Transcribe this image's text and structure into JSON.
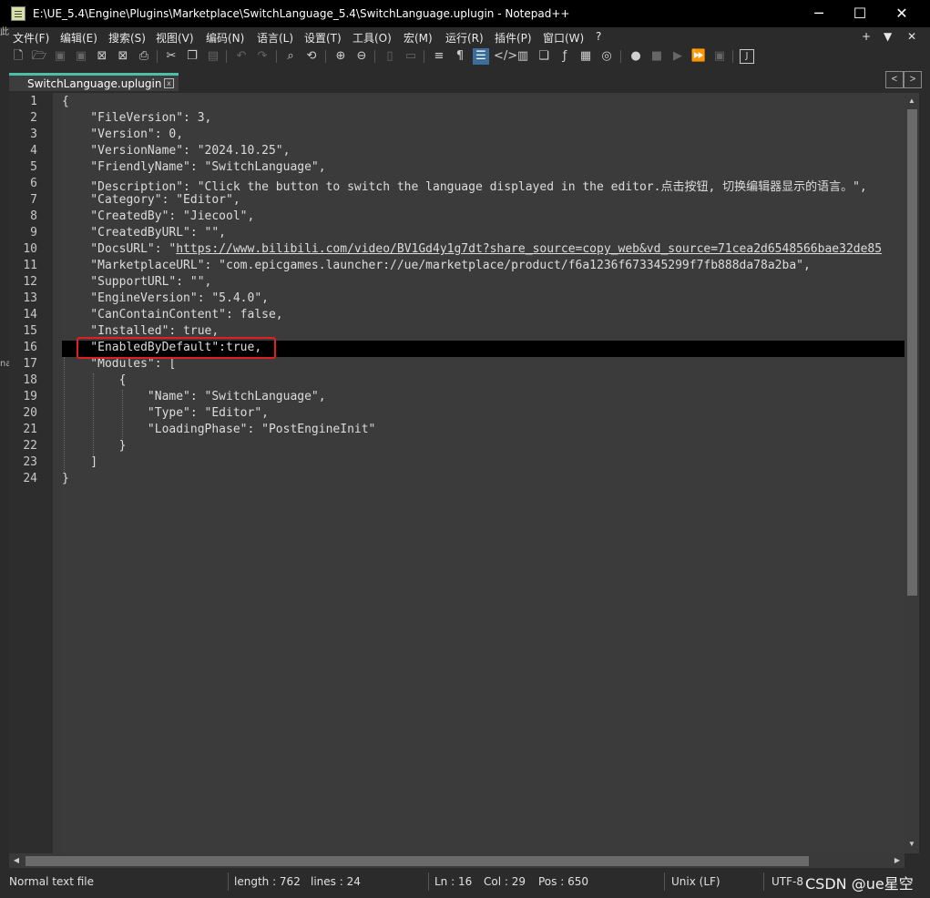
{
  "window": {
    "title": "E:\\UE_5.4\\Engine\\Plugins\\Marketplace\\SwitchLanguage_5.4\\SwitchLanguage.uplugin - Notepad++",
    "minimize": "─",
    "maximize": "☐",
    "close": "✕"
  },
  "menu": {
    "items": [
      "文件(F)",
      "编辑(E)",
      "搜索(S)",
      "视图(V)",
      "编码(N)",
      "语言(L)",
      "设置(T)",
      "工具(O)",
      "宏(M)",
      "运行(R)",
      "插件(P)",
      "窗口(W)",
      "?"
    ],
    "right": [
      "+",
      "▼",
      "✕"
    ]
  },
  "toolbar": {
    "icons": [
      "new-file-icon",
      "open-file-icon",
      "save-icon",
      "save-all-icon",
      "close-icon",
      "close-all-icon",
      "print-icon",
      "cut-icon",
      "copy-icon",
      "paste-icon",
      "undo-icon",
      "redo-icon",
      "find-icon",
      "replace-icon",
      "zoom-in-icon",
      "zoom-out-icon",
      "sync-vertical-icon",
      "sync-horizontal-icon",
      "word-wrap-icon",
      "show-all-chars-icon",
      "indent-guide-icon",
      "udl-icon",
      "doc-map-icon",
      "doc-list-icon",
      "function-list-icon",
      "folder-workspace-icon",
      "monitor-icon",
      "record-macro-icon",
      "stop-record-icon",
      "play-macro-icon",
      "run-macro-multiple-icon",
      "save-macro-icon",
      "json-plugin-icon"
    ]
  },
  "tab": {
    "label": "SwitchLanguage.uplugin",
    "close": "x"
  },
  "tab_nav": {
    "prev": "<",
    "next": ">"
  },
  "editor": {
    "line_numbers": [
      "1",
      "2",
      "3",
      "4",
      "5",
      "6",
      "7",
      "8",
      "9",
      "10",
      "11",
      "12",
      "13",
      "14",
      "15",
      "16",
      "17",
      "18",
      "19",
      "20",
      "21",
      "22",
      "23",
      "24"
    ],
    "lines": [
      "{",
      "    \"FileVersion\": 3,",
      "    \"Version\": 0,",
      "    \"VersionName\": \"2024.10.25\",",
      "    \"FriendlyName\": \"SwitchLanguage\",",
      "    \"Description\": \"Click the button to switch the language displayed in the editor.点击按钮, 切换编辑器显示的语言。\",",
      "    \"Category\": \"Editor\",",
      "    \"CreatedBy\": \"Jiecool\",",
      "    \"CreatedByURL\": \"\",",
      "    \"DocsURL\": \"",
      "    \"MarketplaceURL\": \"com.epicgames.launcher://ue/marketplace/product/f6a1236f673345299f7fb888da78a2ba\",",
      "    \"SupportURL\": \"\",",
      "    \"EngineVersion\": \"5.4.0\",",
      "    \"CanContainContent\": false,",
      "    \"Installed\": true,",
      "    \"EnabledByDefault\":true,",
      "    \"Modules\": [",
      "        {",
      "            \"Name\": \"SwitchLanguage\",",
      "            \"Type\": \"Editor\",",
      "            \"LoadingPhase\": \"PostEngineInit\"",
      "        }",
      "    ]",
      "}"
    ],
    "docs_url": "https://www.bilibili.com/video/BV1Gd4y1g7dt?share_source=copy_web&vd_source=71cea2d6548566bae32de85"
  },
  "status": {
    "file_type": "Normal text file",
    "length": "length : 762",
    "lines": "lines : 24",
    "ln": "Ln : 16",
    "col": "Col : 29",
    "pos": "Pos : 650",
    "eol": "Unix (LF)",
    "encoding": "UTF-8"
  },
  "watermark": "CSDN @ue星空",
  "edge_marks": {
    "top": "此",
    "mid": "na"
  },
  "colors": {
    "tab_accent": "#4bc0a5",
    "highlight_box": "#e02020"
  }
}
